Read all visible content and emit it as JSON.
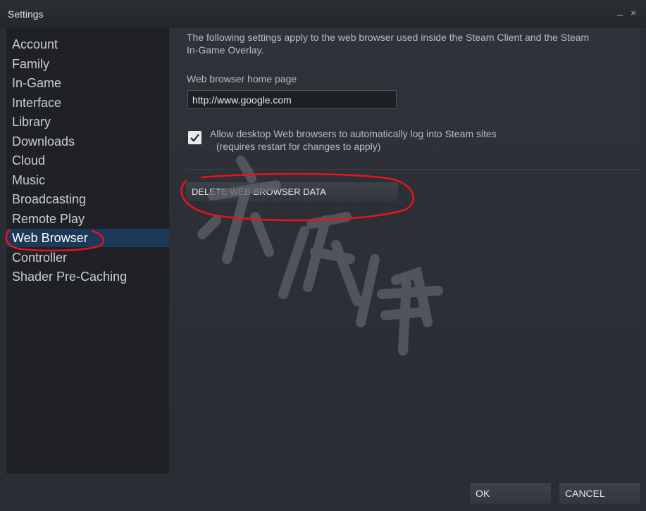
{
  "window": {
    "title": "Settings",
    "minimize_glyph": "_",
    "close_glyph": "×"
  },
  "sidebar": {
    "items": [
      {
        "label": "Account",
        "active": false
      },
      {
        "label": "Family",
        "active": false
      },
      {
        "label": "In-Game",
        "active": false
      },
      {
        "label": "Interface",
        "active": false
      },
      {
        "label": "Library",
        "active": false
      },
      {
        "label": "Downloads",
        "active": false
      },
      {
        "label": "Cloud",
        "active": false
      },
      {
        "label": "Music",
        "active": false
      },
      {
        "label": "Broadcasting",
        "active": false
      },
      {
        "label": "Remote Play",
        "active": false
      },
      {
        "label": "Web Browser",
        "active": true
      },
      {
        "label": "Controller",
        "active": false
      },
      {
        "label": "Shader Pre-Caching",
        "active": false
      }
    ]
  },
  "web_browser": {
    "description_line1": "The following settings apply to the web browser used inside the Steam Client and the Steam",
    "description_line2": "In-Game Overlay.",
    "home_page_label": "Web browser home page",
    "home_page_value": "http://www.google.com",
    "auto_login_label": "Allow desktop Web browsers to automatically log into Steam sites",
    "auto_login_note": "(requires restart for changes to apply)",
    "auto_login_checked": true,
    "delete_button": "DELETE WEB BROWSER DATA"
  },
  "footer": {
    "ok": "OK",
    "cancel": "CANCEL"
  },
  "colors": {
    "accent_selected": "#1b3a59",
    "annotation_red": "#e8141c",
    "background": "#2a2d33"
  }
}
